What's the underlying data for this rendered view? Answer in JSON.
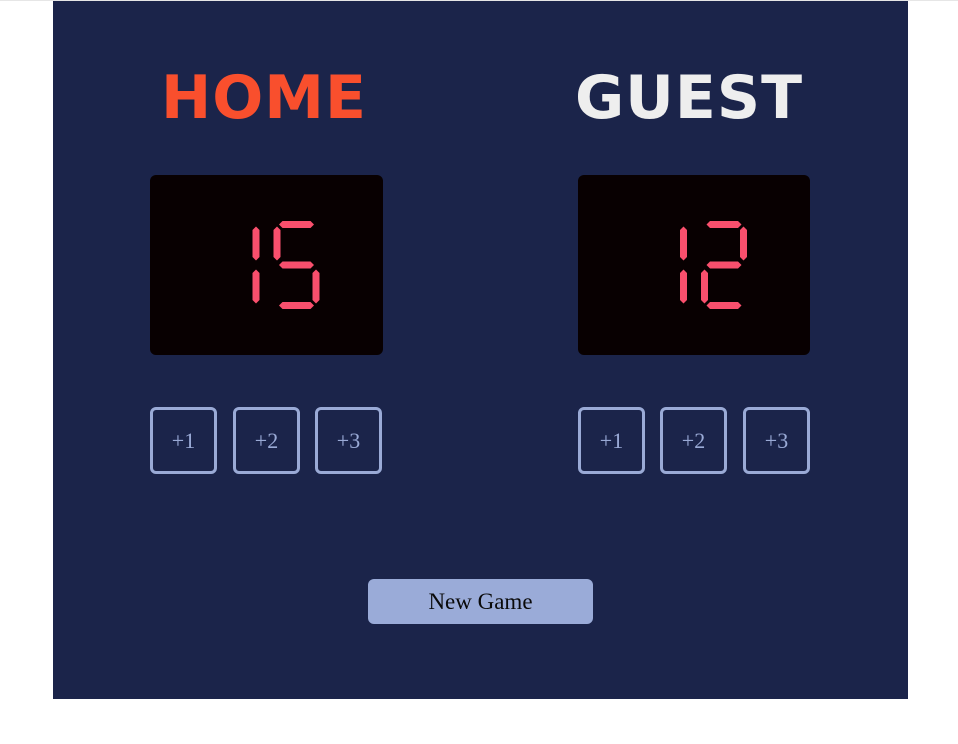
{
  "home": {
    "title": "HOME",
    "score": "15",
    "buttons": [
      "+1",
      "+2",
      "+3"
    ]
  },
  "guest": {
    "title": "GUEST",
    "score": "12",
    "buttons": [
      "+1",
      "+2",
      "+3"
    ]
  },
  "new_game_label": "New Game",
  "colors": {
    "board_bg": "#1b244a",
    "home_title": "#f94f2d",
    "guest_title": "#eeeeee",
    "display_bg": "#080001",
    "digit": "#f94f6d",
    "button_border": "#9aaad6",
    "new_game_bg": "#9aabd8"
  }
}
